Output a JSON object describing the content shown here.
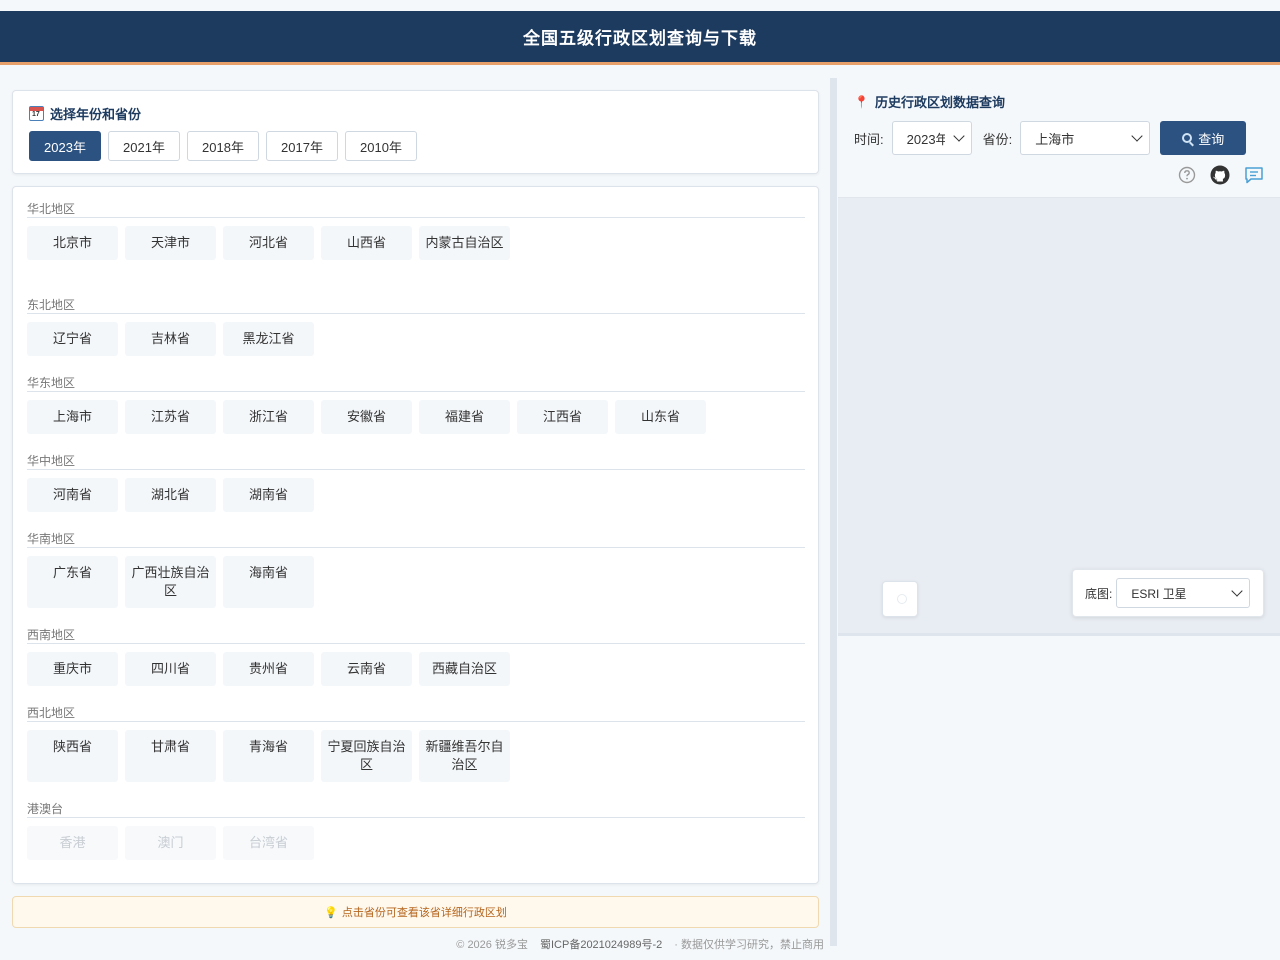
{
  "header": {
    "title": "全国五级行政区划查询与下载"
  },
  "year_section": {
    "title": "选择年份和省份",
    "years": [
      "2023年",
      "2021年",
      "2018年",
      "2017年",
      "2010年"
    ],
    "active": "2023年"
  },
  "regions": [
    {
      "name": "华北地区",
      "provinces": [
        "北京市",
        "天津市",
        "河北省",
        "山西省",
        "内蒙古自治区"
      ]
    },
    {
      "name": "东北地区",
      "provinces": [
        "辽宁省",
        "吉林省",
        "黑龙江省"
      ]
    },
    {
      "name": "华东地区",
      "provinces": [
        "上海市",
        "江苏省",
        "浙江省",
        "安徽省",
        "福建省",
        "江西省",
        "山东省"
      ]
    },
    {
      "name": "华中地区",
      "provinces": [
        "河南省",
        "湖北省",
        "湖南省"
      ]
    },
    {
      "name": "华南地区",
      "provinces": [
        "广东省",
        "广西壮族自治区",
        "海南省"
      ]
    },
    {
      "name": "西南地区",
      "provinces": [
        "重庆市",
        "四川省",
        "贵州省",
        "云南省",
        "西藏自治区"
      ]
    },
    {
      "name": "西北地区",
      "provinces": [
        "陕西省",
        "甘肃省",
        "青海省",
        "宁夏回族自治区",
        "新疆维吾尔自治区"
      ]
    },
    {
      "name": "港澳台",
      "provinces": [
        "香港",
        "澳门",
        "台湾省"
      ],
      "disabled": true
    }
  ],
  "tip": "点击省份可查看该省详细行政区划",
  "footer": {
    "copyright": "© 2026 锐多宝",
    "icp": "蜀ICP备2021024989号-2",
    "notice": "· 数据仅供学习研究，禁止商用"
  },
  "history_query": {
    "title": "历史行政区划数据查询",
    "time_label": "时间:",
    "time_value": "2023年",
    "province_label": "省份:",
    "province_value": "上海市",
    "query_label": "查询"
  },
  "icons": [
    "help-icon",
    "github-icon",
    "feedback-icon"
  ],
  "map": {
    "basemap_label": "底图:",
    "basemap_value": "ESRI 卫星"
  },
  "colors": {
    "primary": "#1d3a5f",
    "accent": "#2c5282",
    "header_underline": "#e8a06a"
  }
}
